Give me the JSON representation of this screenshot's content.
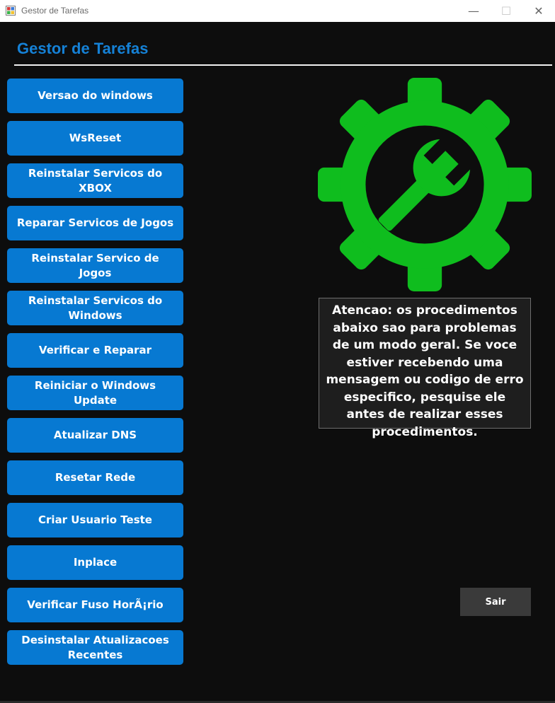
{
  "window": {
    "title": "Gestor de Tarefas",
    "minimize_glyph": "—",
    "maximize_glyph": "☐",
    "close_glyph": "✕"
  },
  "header": {
    "title": "Gestor de Tarefas"
  },
  "buttons": [
    {
      "label": "Versao do windows"
    },
    {
      "label": "WsReset"
    },
    {
      "label": "Reinstalar Servicos do XBOX"
    },
    {
      "label": "Reparar Servicos de Jogos"
    },
    {
      "label": "Reinstalar Servico de Jogos"
    },
    {
      "label": "Reinstalar Servicos do Windows"
    },
    {
      "label": "Verificar e Reparar"
    },
    {
      "label": "Reiniciar o Windows Update"
    },
    {
      "label": "Atualizar DNS"
    },
    {
      "label": "Resetar Rede"
    },
    {
      "label": "Criar Usuario Teste"
    },
    {
      "label": "Inplace"
    },
    {
      "label": "Verificar Fuso HorÃ¡rio"
    },
    {
      "label": "Desinstalar Atualizacoes Recentes"
    }
  ],
  "logo": {
    "icon": "gear-wrench-icon",
    "color": "#0fbd1e"
  },
  "notice": {
    "text": "Atencao: os procedimentos abaixo sao para problemas de um modo geral. Se voce estiver recebendo uma mensagem ou codigo de erro especifico, pesquise ele antes de realizar esses procedimentos."
  },
  "exit": {
    "label": "Sair"
  },
  "colors": {
    "background": "#0d0d0d",
    "accent": "#0779d2",
    "heading": "#1581d6",
    "exit_button": "#3a3a3a"
  }
}
